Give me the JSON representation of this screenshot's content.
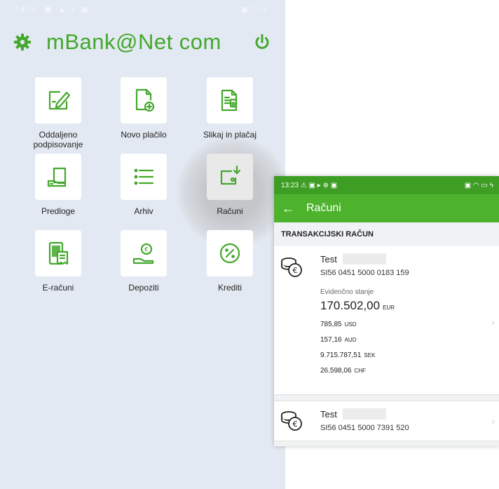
{
  "left": {
    "status": {
      "time": "7:47",
      "icons": "⚠ ▣ ▲ • ▣ ·",
      "right_icons": "▣ ◠ ▭"
    },
    "app_title": "mBank@Net com",
    "tiles": [
      {
        "label": "Oddaljeno podpisovanje"
      },
      {
        "label": "Novo plačilo"
      },
      {
        "label": "Slikaj in plačaj"
      },
      {
        "label": "Predloge"
      },
      {
        "label": "Arhiv"
      },
      {
        "label": "Računi"
      },
      {
        "label": "E-računi"
      },
      {
        "label": "Depoziti"
      },
      {
        "label": "Krediti"
      }
    ]
  },
  "right": {
    "status": {
      "time": "13:23",
      "icons": "⚠ ▣ ▸ ⊕ ▣",
      "right_icons": "▣ ◠ ▭ ϟ"
    },
    "title": "Računi",
    "section": "TRANSAKCIJSKI RAČUN",
    "accounts": [
      {
        "name": "Test",
        "iban": "SI56 0451 5000 0183 159",
        "balance_label": "Evidenčno stanje",
        "balance_value": "170.502,00",
        "balance_currency": "EUR",
        "others": [
          {
            "value": "785,85",
            "currency": "USD"
          },
          {
            "value": "157,16",
            "currency": "AUD"
          },
          {
            "value": "9.715.787,51",
            "currency": "SEK"
          },
          {
            "value": "26.598,06",
            "currency": "CHF"
          }
        ]
      },
      {
        "name": "Test",
        "iban": "SI56 0451 5000 7391 520"
      }
    ]
  },
  "colors": {
    "brand_green": "#4db32d",
    "logo_green": "#43a82b",
    "bg_left": "#e3e9f2"
  }
}
